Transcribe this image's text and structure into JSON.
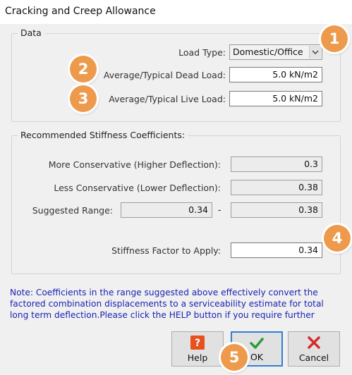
{
  "window": {
    "title": "Cracking and Creep Allowance"
  },
  "data_group": {
    "legend": "Data",
    "load_type": {
      "label": "Load Type:",
      "value": "Domestic/Office"
    },
    "dead_load": {
      "label": "Average/Typical Dead Load:",
      "value": "5.0 kN/m2"
    },
    "live_load": {
      "label": "Average/Typical Live Load:",
      "value": "5.0 kN/m2"
    }
  },
  "stiffness_group": {
    "legend": "Recommended Stiffness Coefficients:",
    "more_conservative": {
      "label": "More Conservative (Higher Deflection):",
      "value": "0.3"
    },
    "less_conservative": {
      "label": "Less Conservative (Lower Deflection):",
      "value": "0.38"
    },
    "suggested_range": {
      "label": "Suggested Range:",
      "low": "0.34",
      "separator": "-",
      "high": "0.38"
    },
    "factor_to_apply": {
      "label": "Stiffness Factor to Apply:",
      "value": "0.34"
    }
  },
  "note": "Note: Coefficients in the range suggested above effectively convert the factored combination displacements to a serviceability estimate for total long term deflection.Please click the HELP button if you require further",
  "buttons": {
    "help": "Help",
    "ok": "OK",
    "cancel": "Cancel"
  },
  "badges": [
    "1",
    "2",
    "3",
    "4",
    "5"
  ],
  "colors": {
    "badge": "#ee9a4c",
    "note_text": "#1c23b3",
    "ok_check": "#2a9d3a",
    "cancel_x": "#d42b2b",
    "help_icon": "#e8501e"
  }
}
